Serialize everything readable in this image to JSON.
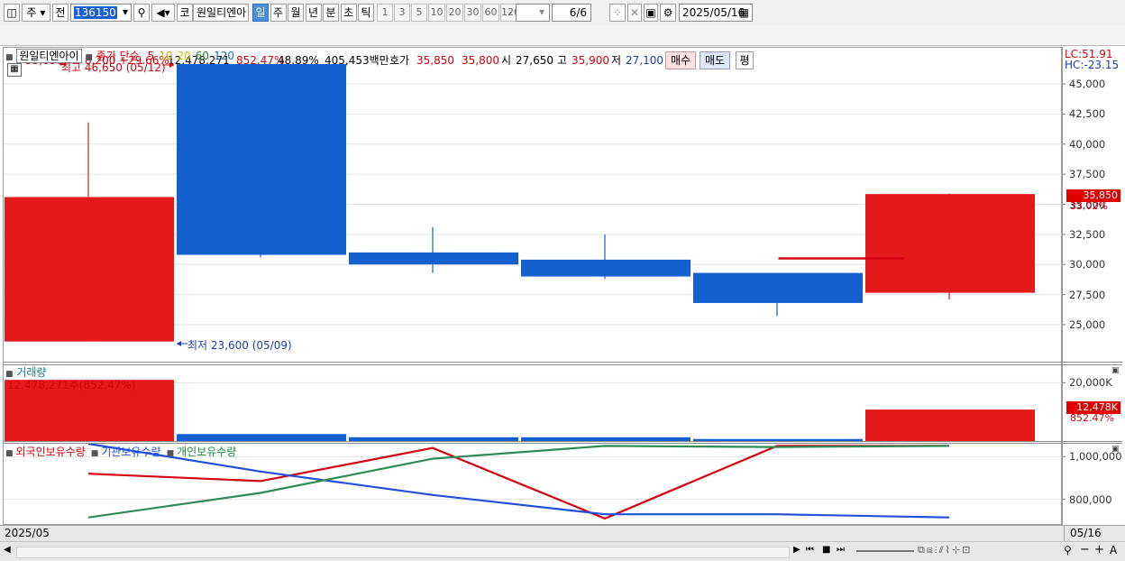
{
  "toolbar": {
    "period_select": "주",
    "prev_label": "전",
    "stock_code": "136150",
    "market_btn": "코",
    "stock_name": "원일티엔아",
    "periods": [
      "일",
      "주",
      "월",
      "년",
      "분",
      "초",
      "틱"
    ],
    "selected_period": "일",
    "intervals": [
      "1",
      "3",
      "5",
      "10",
      "20",
      "30",
      "60",
      "120"
    ],
    "page_indicator": "6/6",
    "date": "2025/05/16"
  },
  "quote": {
    "price": "35,850",
    "change": "8,200",
    "change_pct": "+29.66%",
    "volume": "12,478,271",
    "volume_pct": "852.47%",
    "ratio": "48.89%",
    "amount": "405,453백만",
    "ask_label": "호가",
    "ask_price": "35,850",
    "bid_price": "35,800",
    "open_label": "시",
    "open": "27,650",
    "high_label": "고",
    "high": "35,900",
    "low_label": "저",
    "low": "27,100",
    "buy_label": "매수",
    "sell_label": "매도",
    "eval_label": "평"
  },
  "price_panel": {
    "stock_label": "원일티엔아이",
    "ma_prefix": "종가 단순",
    "ma_periods": [
      {
        "label": "5",
        "color": "#d4000f"
      },
      {
        "label": "10",
        "color": "#e8a000"
      },
      {
        "label": "20",
        "color": "#c8c800"
      },
      {
        "label": "60",
        "color": "#1a8a3a"
      },
      {
        "label": "120",
        "color": "#1a6fb8"
      }
    ],
    "high_annotation": "최고 46,650 (05/12)",
    "low_annotation": "최저 23,600 (05/09)",
    "lc": "LC:51.91",
    "hc": "HC:-23.15",
    "last_price_tag": "35,850",
    "last_pct": "33.02%"
  },
  "volume_panel": {
    "title": "거래량",
    "annotation": "12,478,271주(852.47%)",
    "last_tag": "12,478K",
    "last_pct": "852.47%"
  },
  "holdings_panel": {
    "legend": [
      {
        "label": "외국인보유수량",
        "color": "#d4000f"
      },
      {
        "label": "기관보유수량",
        "color": "#2050d8"
      },
      {
        "label": "개인보유수량",
        "color": "#1a8a3a"
      }
    ]
  },
  "x_axis": {
    "start_label": "2025/05",
    "end_label": "05/16"
  },
  "chart_data": [
    {
      "type": "candlestick",
      "ylim": [
        22000,
        48000
      ],
      "yticks": [
        "45,000",
        "42,500",
        "40,000",
        "37,500",
        "35,000",
        "32,500",
        "30,000",
        "27,500",
        "25,000"
      ],
      "candles": [
        {
          "open": 23600,
          "close": 35600,
          "high": 41800,
          "low": 23600,
          "color": "#e41a1a"
        },
        {
          "open": 46650,
          "close": 30800,
          "high": 46650,
          "low": 30600,
          "color": "#1560cf"
        },
        {
          "open": 31000,
          "close": 30000,
          "high": 33100,
          "low": 29300,
          "color": "#1560cf"
        },
        {
          "open": 30400,
          "close": 29000,
          "high": 32500,
          "low": 28800,
          "color": "#1560cf"
        },
        {
          "open": 29300,
          "close": 26800,
          "high": 29300,
          "low": 25700,
          "color": "#1560cf"
        },
        {
          "open": 27650,
          "close": 35850,
          "high": 35900,
          "low": 27100,
          "color": "#e41a1a"
        }
      ],
      "ma5_segment": {
        "from": 4.5,
        "to": 5.5,
        "value": 30500
      }
    },
    {
      "type": "bar",
      "ylim": [
        0,
        26000
      ],
      "yticks": [
        "20,000K"
      ],
      "values": [
        21000,
        2400,
        1300,
        1300,
        700,
        10800
      ],
      "colors": [
        "#e41a1a",
        "#1560cf",
        "#1560cf",
        "#1560cf",
        "#1560cf",
        "#e41a1a"
      ]
    },
    {
      "type": "line",
      "ylim": [
        680000,
        1060000
      ],
      "yticks": [
        "1,000,000",
        "800,000"
      ],
      "series": [
        {
          "name": "외국인보유수량",
          "color": "#d4000f",
          "values": [
            920000,
            885000,
            1040000,
            710000,
            1050000,
            1050000
          ]
        },
        {
          "name": "기관보유수량",
          "color": "#2050d8",
          "values": [
            1060000,
            930000,
            820000,
            730000,
            730000,
            715000
          ]
        },
        {
          "name": "개인보유수량",
          "color": "#2e8b57",
          "values": [
            715000,
            830000,
            990000,
            1050000,
            1045000,
            1050000
          ]
        }
      ]
    }
  ]
}
